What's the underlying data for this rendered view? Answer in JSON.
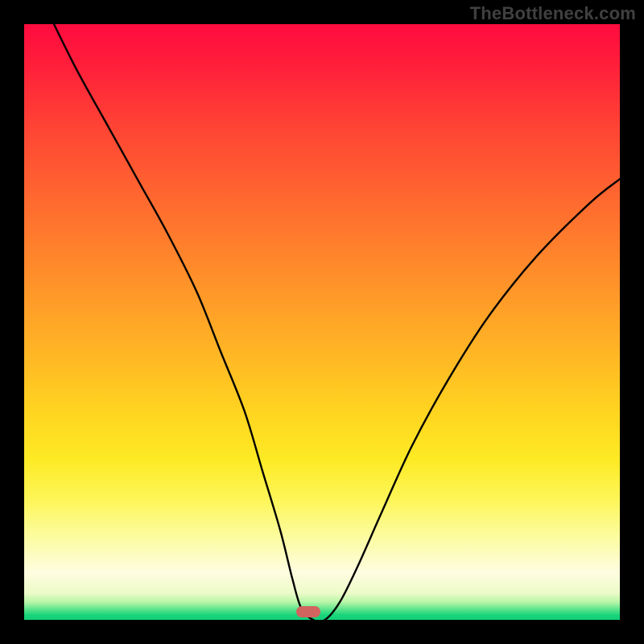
{
  "watermark": "TheBottleneck.com",
  "colors": {
    "frame_bg": "#000000",
    "curve_stroke": "#000000",
    "marker_fill": "#d1645f",
    "gradient_top": "#ff0b3f",
    "gradient_bottom": "#11cf78"
  },
  "marker": {
    "x_frac": 0.477,
    "y_frac": 0.987
  },
  "chart_data": {
    "type": "line",
    "title": "",
    "xlabel": "",
    "ylabel": "",
    "xlim": [
      0,
      100
    ],
    "ylim": [
      0,
      100
    ],
    "series": [
      {
        "name": "bottleneck-curve",
        "x": [
          5,
          9,
          14,
          19,
          24,
          29,
          33,
          37,
          40,
          43,
          45,
          46.5,
          48.5,
          50.5,
          53,
          56,
          60,
          65,
          71,
          78,
          86,
          95,
          100
        ],
        "y": [
          100,
          92,
          83,
          74,
          65,
          55,
          45,
          35,
          25,
          15,
          7,
          2,
          0,
          0,
          3,
          9,
          18,
          29,
          40,
          51,
          61,
          70,
          74
        ]
      }
    ],
    "annotations": [
      {
        "text": "TheBottleneck.com",
        "role": "watermark",
        "pos": "top-right"
      }
    ],
    "background_gradient": {
      "direction": "vertical",
      "stops": [
        {
          "pos": 0.0,
          "color": "#ff0b3f"
        },
        {
          "pos": 0.3,
          "color": "#ff6a2f"
        },
        {
          "pos": 0.65,
          "color": "#ffd420"
        },
        {
          "pos": 0.86,
          "color": "#fcfc9f"
        },
        {
          "pos": 0.97,
          "color": "#b8f6a8"
        },
        {
          "pos": 1.0,
          "color": "#11cf78"
        }
      ]
    },
    "optimum_marker": {
      "x": 49.5,
      "y": 0,
      "shape": "pill",
      "color": "#d1645f"
    }
  }
}
